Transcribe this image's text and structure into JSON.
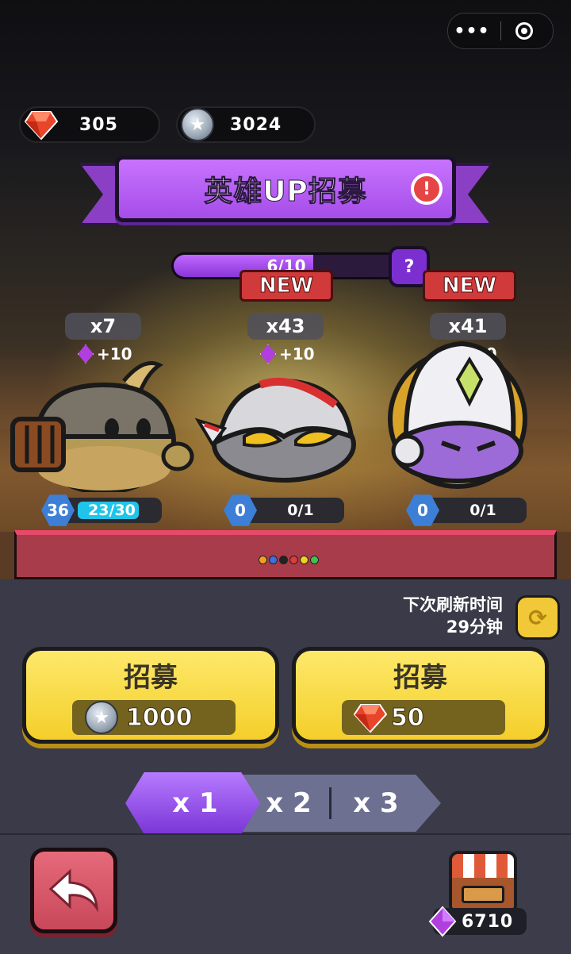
{
  "top_capsule": {
    "more_icon": "more-dots-icon",
    "close_icon": "target-circle-icon",
    "more_label": "•••"
  },
  "currencies": {
    "ruby": {
      "icon": "ruby-gem-icon",
      "value": "305",
      "color": "#e8452a"
    },
    "coin": {
      "icon": "silver-star-coin-icon",
      "value": "3024",
      "color": "#a9b4c1"
    }
  },
  "banner": {
    "title": "英雄UP招募",
    "alert_label": "!",
    "color": "#b45cf0"
  },
  "progress": {
    "text": "6/10",
    "current": 6,
    "max": 10,
    "help_label": "?"
  },
  "heroes": [
    {
      "name_icon": "onion-dome-hero",
      "count": "x7",
      "gem_bonus": "+10",
      "level": "36",
      "xp_text": "23/30",
      "xp_fraction": 0.77,
      "is_new": false
    },
    {
      "name_icon": "silver-helmet-hero",
      "count": "x43",
      "gem_bonus": "+10",
      "level": "0",
      "xp_text": "0/1",
      "xp_fraction": 0,
      "is_new": true,
      "new_label": "NEW"
    },
    {
      "name_icon": "purple-gear-knight-hero",
      "count": "x41",
      "gem_bonus": "+10",
      "level": "0",
      "xp_text": "0/1",
      "xp_fraction": 0,
      "is_new": true,
      "new_label": "NEW"
    }
  ],
  "page_dots": [
    "#f0a020",
    "#3a70e0",
    "#222222",
    "#e03a3a",
    "#f0d020",
    "#40c050"
  ],
  "refresh": {
    "line1": "下次刷新时间",
    "line2": "29分钟",
    "icon": "refresh-arrows-icon"
  },
  "recruit_buttons": [
    {
      "title": "招募",
      "cost": "1000",
      "currency_icon": "silver-star-coin-icon"
    },
    {
      "title": "招募",
      "cost": "50",
      "currency_icon": "ruby-gem-icon"
    }
  ],
  "multiplier": {
    "options": [
      "x 1",
      "x 2",
      "x 3"
    ],
    "selected": "x 1"
  },
  "bottom": {
    "back_icon": "back-arrow-icon",
    "shop_icon": "shop-stall-icon",
    "gem_count": "6710"
  }
}
